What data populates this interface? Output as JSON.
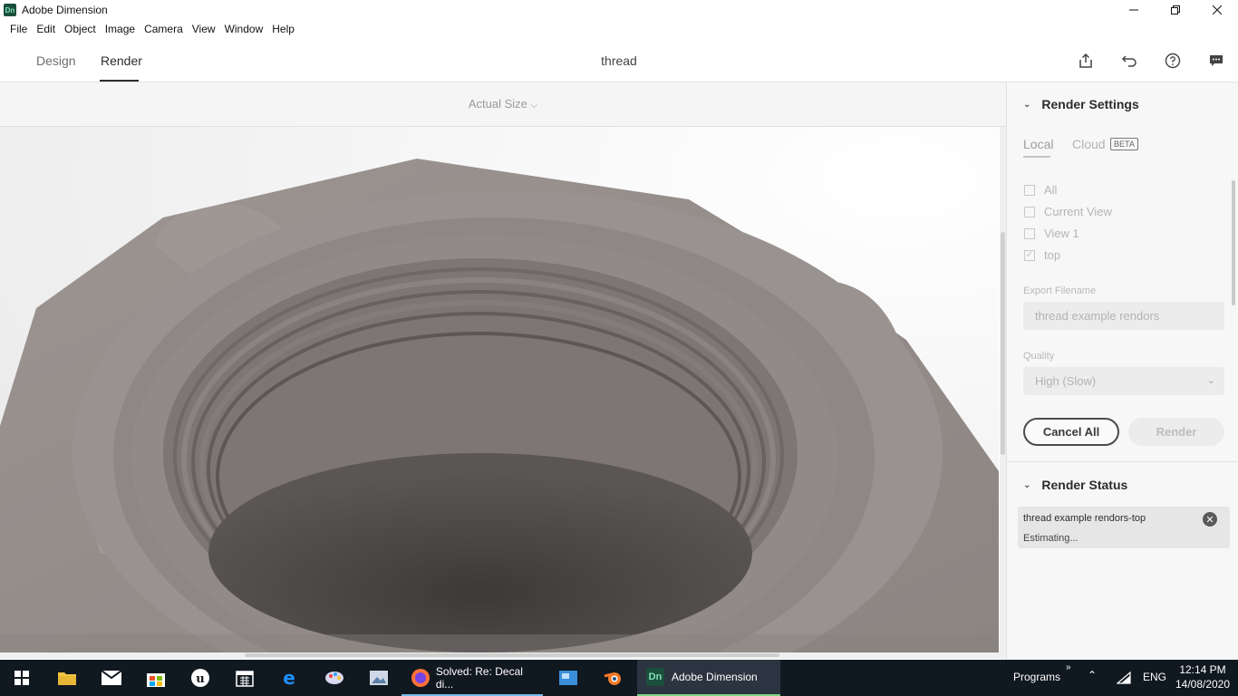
{
  "window": {
    "app_icon": "Dn",
    "title": "Adobe Dimension",
    "controls": [
      "minimize-icon",
      "restore-icon",
      "close-icon"
    ]
  },
  "menu": [
    "File",
    "Edit",
    "Object",
    "Image",
    "Camera",
    "View",
    "Window",
    "Help"
  ],
  "header": {
    "tabs": [
      {
        "label": "Design",
        "active": false
      },
      {
        "label": "Render",
        "active": true
      }
    ],
    "document_title": "thread",
    "icons": [
      "share-icon",
      "undo-icon",
      "help-icon",
      "feedback-icon"
    ]
  },
  "viewport": {
    "zoom_label": "Actual Size"
  },
  "render_settings": {
    "title": "Render Settings",
    "tabs": [
      {
        "label": "Local",
        "active": true
      },
      {
        "label": "Cloud",
        "badge": "BETA",
        "active": false
      }
    ],
    "views": [
      {
        "label": "All",
        "checked": false
      },
      {
        "label": "Current View",
        "checked": false
      },
      {
        "label": "View 1",
        "checked": false
      },
      {
        "label": "top",
        "checked": true
      }
    ],
    "export_filename_label": "Export Filename",
    "export_filename_value": "thread example rendors",
    "quality_label": "Quality",
    "quality_value": "High (Slow)",
    "cancel_all_label": "Cancel All",
    "render_label": "Render"
  },
  "render_status": {
    "title": "Render Status",
    "job_name": "thread example rendors-top",
    "job_status": "Estimating..."
  },
  "taskbar": {
    "apps": [
      {
        "icon": "windows-start-icon"
      },
      {
        "icon": "file-explorer-icon"
      },
      {
        "icon": "mail-icon"
      },
      {
        "icon": "store-icon"
      },
      {
        "icon": "unreal-engine-icon"
      },
      {
        "icon": "calendar-icon"
      },
      {
        "icon": "edge-icon"
      },
      {
        "icon": "paint-icon"
      },
      {
        "icon": "photos-icon"
      },
      {
        "icon": "firefox-icon",
        "label": "Solved: Re: Decal di..."
      },
      {
        "icon": "control-panel-icon"
      },
      {
        "icon": "blender-icon"
      },
      {
        "icon": "dimension-icon",
        "label": "Adobe Dimension"
      }
    ],
    "programs_label": "Programs",
    "language": "ENG",
    "time": "12:14 PM",
    "date": "14/08/2020"
  }
}
